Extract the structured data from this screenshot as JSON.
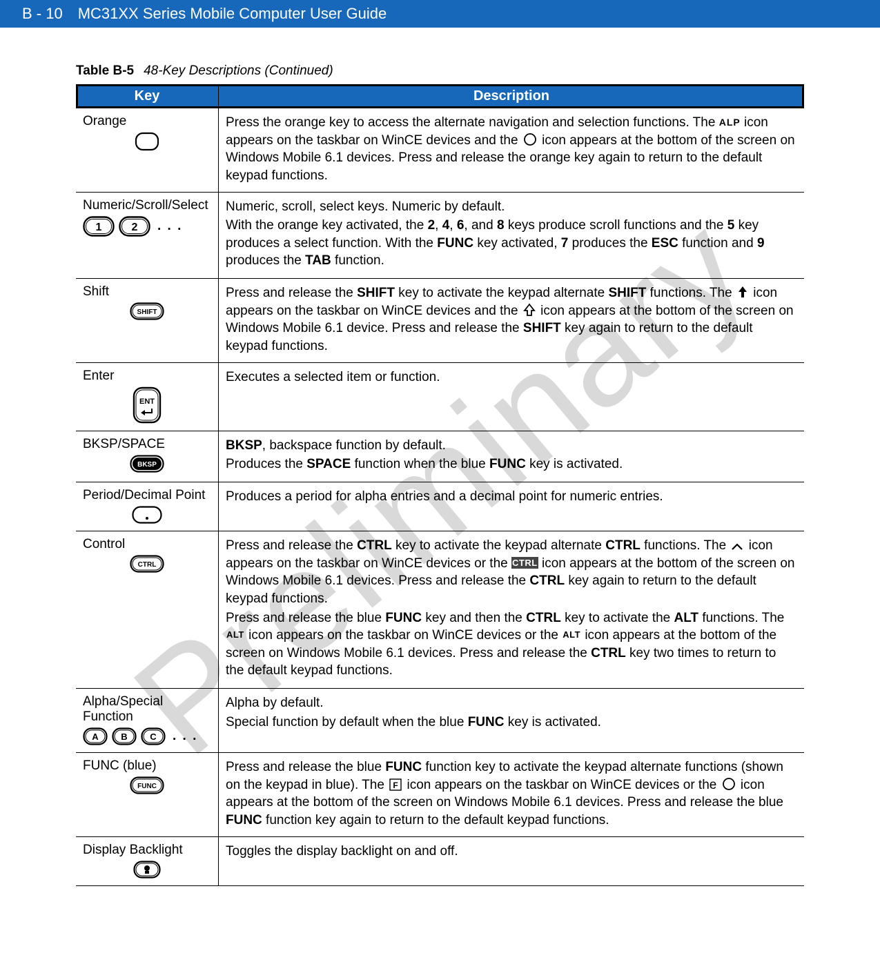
{
  "watermark": "Preliminary",
  "header": {
    "page": "B - 10",
    "title": "MC31XX Series Mobile Computer User Guide"
  },
  "caption": {
    "label": "Table B-5",
    "title": "48-Key Descriptions (Continued)"
  },
  "cols": {
    "key": "Key",
    "desc": "Description"
  },
  "rows": {
    "orange": {
      "name": "Orange",
      "d1": "Press the orange key to access the alternate navigation and selection functions. The ",
      "d2": " icon appears on the taskbar on WinCE devices and the ",
      "d3": " icon appears at the bottom of the screen on Windows Mobile 6.1 devices. Press and release the orange key again to return to the default keypad functions."
    },
    "numeric": {
      "name": "Numeric/Scroll/Select",
      "dots": ". . .",
      "d1": "Numeric, scroll, select keys. Numeric by default.",
      "d2a": "With the orange key activated, the ",
      "b2": "2",
      "d2b": ", ",
      "b4": "4",
      "d2c": ", ",
      "b6": "6",
      "d2d": ", and ",
      "b8": "8",
      "d2e": " keys produce scroll functions and the ",
      "b5": "5",
      "d2f": " key produces a select function. With the ",
      "bfunc": "FUNC",
      "d2g": " key activated, ",
      "b7": "7",
      "d2h": " produces the ",
      "besc": "ESC",
      "d2i": " function and ",
      "b9": "9",
      "d2j": " produces the ",
      "btab": "TAB",
      "d2k": " function."
    },
    "shift": {
      "name": "Shift",
      "d1a": "Press and release the ",
      "b1": "SHIFT",
      "d1b": " key to activate the keypad alternate ",
      "b2": "SHIFT",
      "d1c": " functions. The ",
      "d2": " icon appears on the taskbar on WinCE devices and the ",
      "d3": " icon appears at the bottom of the screen on Windows Mobile 6.1 device. Press and release the ",
      "b3": "SHIFT",
      "d4": " key again to return to the default keypad functions."
    },
    "enter": {
      "name": "Enter",
      "d1": "Executes a selected item or function."
    },
    "bksp": {
      "name": "BKSP/SPACE",
      "b1": "BKSP",
      "d1": ", backspace function by default.",
      "d2a": "Produces the ",
      "b2": "SPACE",
      "d2b": " function when the blue ",
      "b3": "FUNC",
      "d2c": " key is activated."
    },
    "period": {
      "name": "Period/Decimal Point",
      "d1": "Produces a period for alpha entries and a decimal point for numeric entries."
    },
    "ctrl": {
      "name": "Control",
      "p1a": "Press and release the ",
      "b1": "CTRL",
      "p1b": " key to activate the keypad alternate ",
      "b2": "CTRL",
      "p1c": " functions. The ",
      "p1d": " icon appears on the taskbar on WinCE devices or the ",
      "p1e": " icon appears at the bottom of the screen on Windows Mobile 6.1 devices. Press and release the ",
      "b3": "CTRL",
      "p1f": " key again to return to the default keypad functions.",
      "p2a": "Press and release the blue ",
      "b4": "FUNC",
      "p2b": " key and then the ",
      "b5": "CTRL",
      "p2c": " key to activate the ",
      "b6": "ALT",
      "p2d": " functions. The ",
      "p2e": " icon appears on the taskbar on WinCE devices or the ",
      "p2f": " icon appears at the bottom of the screen on Windows Mobile 6.1 devices. Press and release the ",
      "b7": "CTRL",
      "p2g": " key two times to return to the default keypad functions.",
      "altLabel": "ALT",
      "ctrlLabel": "CTRL"
    },
    "alpha": {
      "name": "Alpha/Special Function",
      "dots": ". . .",
      "d1": "Alpha by default.",
      "d2a": "Special function by default when the blue ",
      "b1": "FUNC",
      "d2b": " key is activated."
    },
    "func": {
      "name": "FUNC (blue)",
      "d1a": "Press and release the blue ",
      "b1": "FUNC",
      "d1b": " function key to activate the keypad alternate functions (shown on the keypad in blue). The ",
      "d1c": " icon appears on the taskbar on WinCE devices or the ",
      "d1d": " icon appears at the bottom of the screen on Windows Mobile 6.1 devices. Press and release the blue ",
      "b2": "FUNC",
      "d1e": " function key again to return to the default keypad functions."
    },
    "backlight": {
      "name": "Display Backlight",
      "d1": "Toggles the display backlight on and off."
    }
  }
}
